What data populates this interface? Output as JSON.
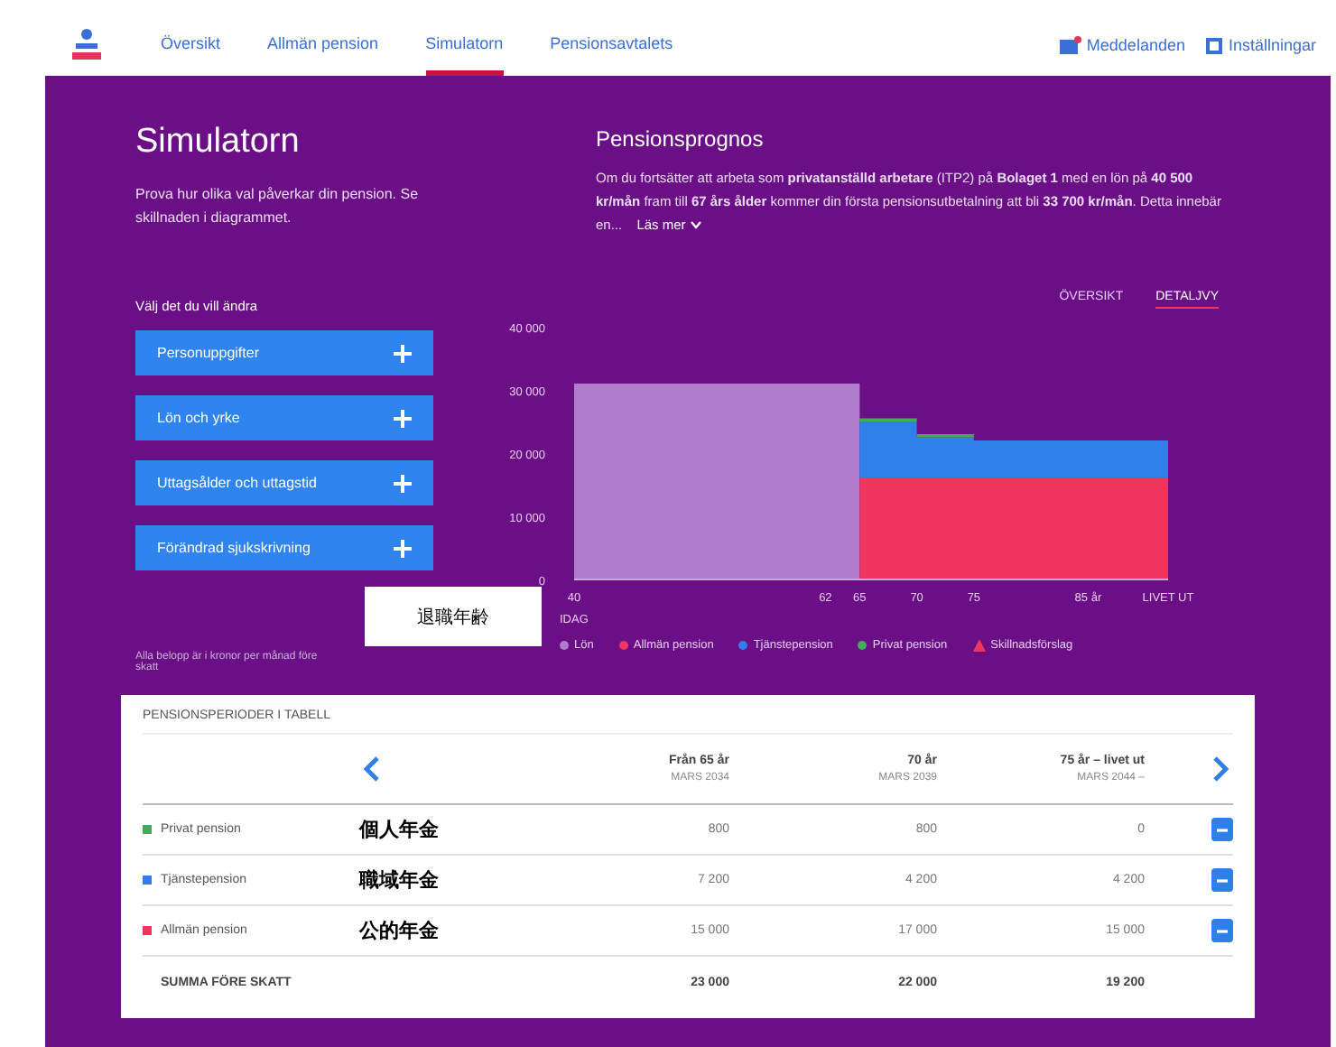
{
  "nav": {
    "items": [
      {
        "label": "Översikt",
        "selected": false
      },
      {
        "label": "Allmän pension",
        "selected": false
      },
      {
        "label": "Simulatorn",
        "selected": true
      },
      {
        "label": "Pensionsavtalets",
        "selected": false
      }
    ],
    "actions": [
      "Meddelanden",
      "Inställningar"
    ]
  },
  "intro": {
    "title": "Simulatorn",
    "text": "Prova hur olika val påverkar din pension. Se skillnaden i diagrammet."
  },
  "forecast": {
    "title": "Pensionsprognos",
    "text": "Om du fortsätter att arbeta som **privatanställd arbetare** (ITP2) på **Bolaget 1** med en lön på **40 500 kr/mån** fram till **67 års ålder** kommer din första pensionsutbetalning att bli **33 700 kr/mån**. Detta innebär en...",
    "link": "Läs mer"
  },
  "choices": {
    "title": "Välj det du vill ändra",
    "buttons": [
      "Personuppgifter",
      "Lön och yrke",
      "Uttagsålder och uttagstid",
      "Förändrad sjukskrivning"
    ],
    "note": "Alla belopp är i kronor per månad före skatt"
  },
  "chart_tabs": [
    {
      "label": "ÖVERSIKT",
      "selected": false
    },
    {
      "label": "DETALJVY",
      "selected": true
    }
  ],
  "chart": {
    "chart_data": {
      "type": "area",
      "stacked": true,
      "x": [
        40,
        65,
        65,
        70,
        70,
        75,
        75,
        92
      ],
      "series": [
        {
          "name": "Lön",
          "color": "#b07ccc",
          "values": [
            31000,
            31000,
            null,
            null,
            null,
            null,
            null,
            null
          ]
        },
        {
          "name": "Allmän pension",
          "color": "#f0355f",
          "values": [
            null,
            null,
            16000,
            16000,
            16000,
            16000,
            16000,
            16000
          ]
        },
        {
          "name": "Tjänstepension",
          "color": "#2f7fe8",
          "values": [
            null,
            null,
            9000,
            9000,
            6500,
            6500,
            6000,
            6000
          ]
        },
        {
          "name": "Privat pension",
          "color": "#3fae5a",
          "values": [
            null,
            null,
            500,
            500,
            500,
            500,
            0,
            0
          ]
        }
      ],
      "xlim": [
        40,
        92
      ],
      "xticks": [
        40,
        62,
        65,
        70,
        75,
        {
          "value": 85,
          "label": "85 år"
        },
        {
          "value": 92,
          "label": "LIVET UT"
        }
      ],
      "ylim": [
        0,
        40000
      ],
      "yticks": [
        {
          "value": 0,
          "label": "0"
        },
        {
          "value": 10000,
          "label": "10 000"
        },
        {
          "value": 20000,
          "label": "20 000"
        },
        {
          "value": 30000,
          "label": "30 000"
        },
        {
          "value": 40000,
          "label": "40 000"
        }
      ]
    },
    "today": "IDAG",
    "annotation": "退職年齢",
    "legend_extra": {
      "label": "Skillnadsförslag",
      "color": "#f0355f"
    }
  },
  "table": {
    "title": "PENSIONSPERIODER I TABELL",
    "columns": [
      {
        "label": "Från 65 år",
        "date": "MARS 2034"
      },
      {
        "label": "70 år",
        "date": "MARS 2039"
      },
      {
        "label": "75 år – livet ut",
        "date": "MARS 2044 –"
      }
    ],
    "rows": [
      {
        "label": "Privat pension",
        "note": "個人年金",
        "color": "#3fae5a",
        "values": [
          "800",
          "800",
          "0"
        ]
      },
      {
        "label": "Tjänstepension",
        "note": "職域年金",
        "color": "#2f7fe8",
        "values": [
          "7 200",
          "4 200",
          "4 200"
        ]
      },
      {
        "label": "Allmän pension",
        "note": "公的年金",
        "color": "#f0355f",
        "values": [
          "15 000",
          "17 000",
          "15 000"
        ]
      }
    ],
    "total": {
      "label": "SUMMA FÖRE SKATT",
      "values": [
        "23 000",
        "22 000",
        "19 200"
      ]
    }
  }
}
